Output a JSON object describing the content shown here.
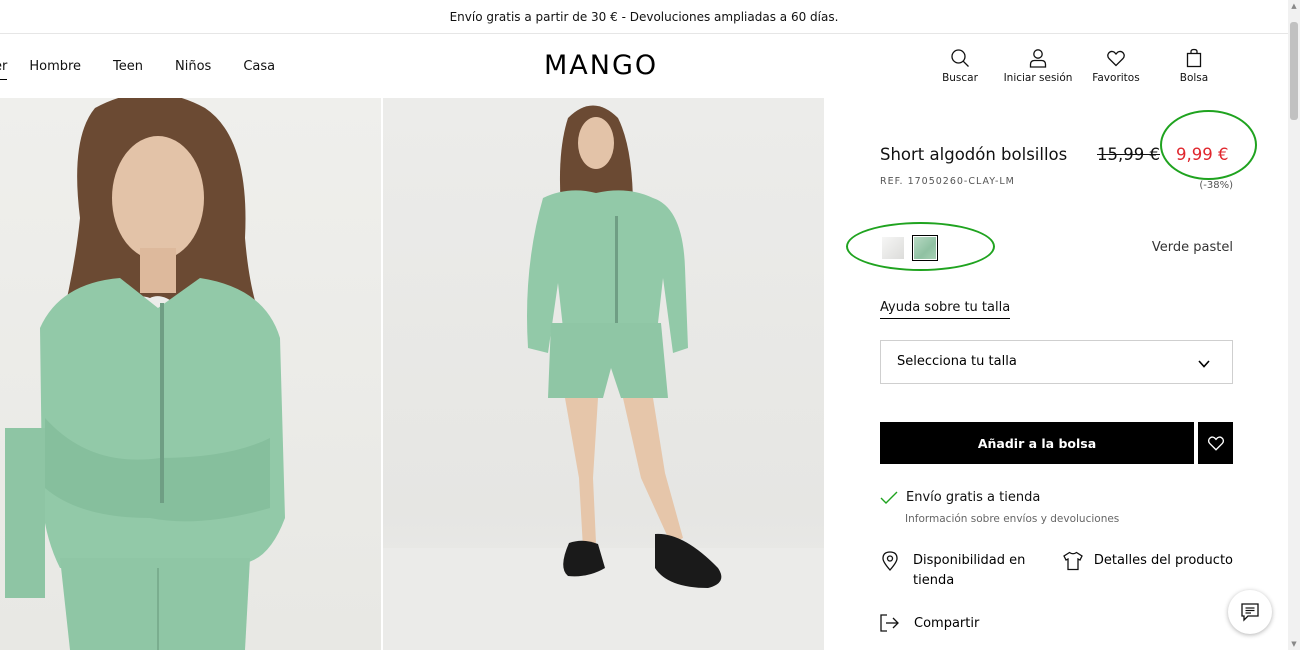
{
  "promo": {
    "text": "Envío gratis a partir de 30 € - Devoluciones ampliadas a 60 días."
  },
  "header": {
    "nav": [
      "er",
      "Hombre",
      "Teen",
      "Niños",
      "Casa"
    ],
    "logo": "MANGO",
    "tools": [
      {
        "label": "Buscar",
        "icon": "search-icon"
      },
      {
        "label": "Iniciar sesión",
        "icon": "user-icon"
      },
      {
        "label": "Favoritos",
        "icon": "heart-icon"
      },
      {
        "label": "Bolsa",
        "icon": "bag-icon"
      }
    ]
  },
  "product": {
    "title": "Short algodón bolsillos",
    "old_price": "15,99 €",
    "new_price": "9,99 €",
    "ref": "REF. 17050260-CLAY-LM",
    "discount": "(-38%)",
    "color_name": "Verde pastel",
    "size_help": "Ayuda sobre tu talla",
    "size_select": "Selecciona tu talla",
    "add_to_bag": "Añadir a la bolsa",
    "shipping": "Envío gratis a tienda",
    "shipping_info": "Información sobre envíos y devoluciones",
    "availability": "Disponibilidad en tienda",
    "details": "Detalles del producto",
    "share": "Compartir"
  },
  "colors": {
    "accent_price": "#e0262d",
    "highlight_circle": "#1fa31f",
    "swatch_selected": "#9fcbb0"
  }
}
